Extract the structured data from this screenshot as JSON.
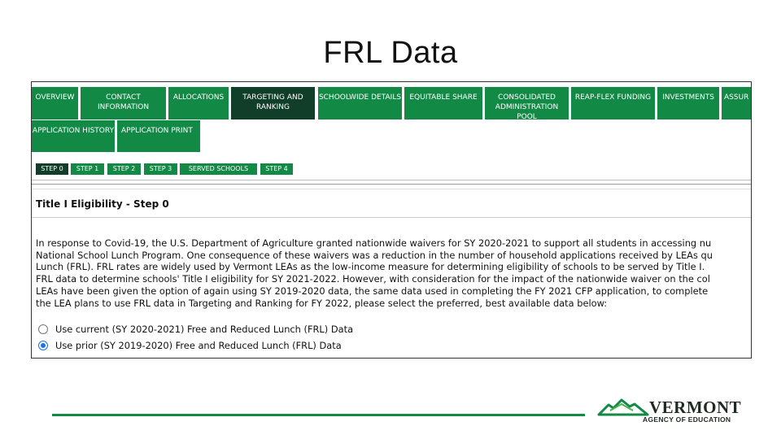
{
  "slide": {
    "title": "FRL Data"
  },
  "nav": {
    "tabs": [
      {
        "label": "OVERVIEW"
      },
      {
        "label": "CONTACT INFORMATION"
      },
      {
        "label": "ALLOCATIONS"
      },
      {
        "label": "TARGETING AND RANKING",
        "active": true
      },
      {
        "label": "SCHOOLWIDE DETAILS"
      },
      {
        "label": "EQUITABLE SHARE"
      },
      {
        "label": "CONSOLIDATED ADMINISTRATION POOL"
      },
      {
        "label": "REAP-FLEX FUNDING"
      },
      {
        "label": "INVESTMENTS"
      },
      {
        "label": "ASSUR"
      }
    ],
    "subtabs": [
      {
        "label": "APPLICATION HISTORY"
      },
      {
        "label": "APPLICATION PRINT"
      }
    ],
    "steps": [
      {
        "label": "STEP 0",
        "active": true
      },
      {
        "label": "STEP 1"
      },
      {
        "label": "STEP 2"
      },
      {
        "label": "STEP 3"
      },
      {
        "label": "SERVED SCHOOLS"
      },
      {
        "label": "STEP 4"
      }
    ]
  },
  "panel": {
    "title": "Title I Eligibility - Step 0",
    "body_lines": [
      "In response to Covid-19, the U.S. Department of Agriculture granted nationwide waivers for SY 2020-2021 to support all students in accessing nu",
      "National School Lunch Program. One consequence of these waivers was a reduction in the number of household applications received by LEAs qu",
      "Lunch (FRL). FRL rates are widely used by Vermont LEAs as the low-income measure for determining eligibility of schools to be served by Title I.",
      "FRL data to determine schools' Title I eligibility for SY 2021-2022. However, with consideration for the impact of the nationwide waiver on the col",
      "LEAs have been given the option of again using SY 2019-2020 data, the same data used in completing the FY 2021 CFP application, to complete",
      "the LEA plans to use FRL data in Targeting and Ranking for FY 2022, please select the preferred, best available data below:"
    ],
    "options": [
      {
        "label": "Use current (SY 2020-2021) Free and Reduced Lunch (FRL) Data",
        "selected": false
      },
      {
        "label": "Use prior (SY 2019-2020) Free and Reduced Lunch (FRL) Data",
        "selected": true
      }
    ]
  },
  "branding": {
    "name": "VERMONT",
    "subtitle": "AGENCY OF EDUCATION",
    "accent_color": "#128a46"
  }
}
